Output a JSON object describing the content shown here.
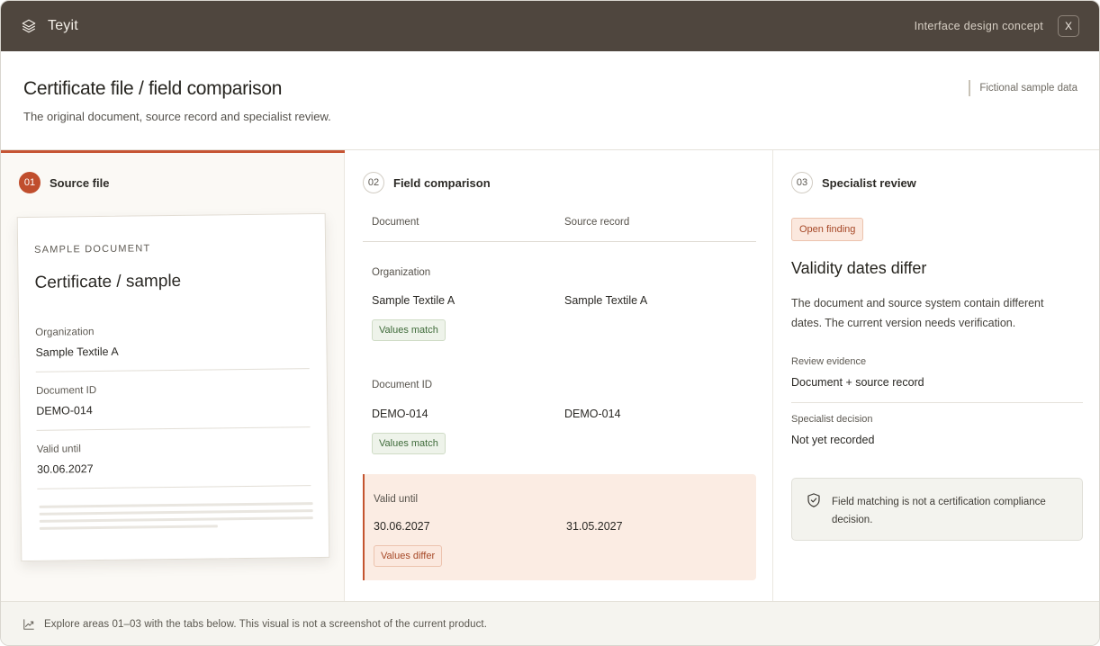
{
  "titlebar": {
    "brand_name": "Teyit",
    "concept_label": "Interface design concept",
    "close_label": "X"
  },
  "header": {
    "title": "Certificate file / field comparison",
    "subtitle": "The original document, source record and specialist review.",
    "sample_tag": "Fictional sample data"
  },
  "steps": [
    {
      "number": "01",
      "label": "Source file"
    },
    {
      "number": "02",
      "label": "Field comparison"
    },
    {
      "number": "03",
      "label": "Specialist review"
    }
  ],
  "document": {
    "kicker": "SAMPLE DOCUMENT",
    "title": "Certificate / sample",
    "fields": [
      {
        "label": "Organization",
        "value": "Sample Textile A"
      },
      {
        "label": "Document ID",
        "value": "DEMO-014"
      },
      {
        "label": "Valid until",
        "value": "30.06.2027"
      }
    ]
  },
  "comparison": {
    "col_document": "Document",
    "col_source": "Source record",
    "rows": [
      {
        "label": "Organization",
        "document": "Sample Textile A",
        "source": "Sample Textile A",
        "status": "Values match"
      },
      {
        "label": "Document ID",
        "document": "DEMO-014",
        "source": "DEMO-014",
        "status": "Values match"
      },
      {
        "label": "Valid until",
        "document": "30.06.2027",
        "source": "31.05.2027",
        "status": "Values differ"
      }
    ]
  },
  "review": {
    "badge": "Open finding",
    "title": "Validity dates differ",
    "text": "The document and source system contain different dates. The current version needs verification.",
    "evidence_label": "Review evidence",
    "evidence_value": "Document + source record",
    "decision_label": "Specialist decision",
    "decision_value": "Not yet recorded",
    "note": "Field matching is not a certification compliance decision."
  },
  "footer": {
    "text": "Explore areas 01–03 with the tabs below. This visual is not a screenshot of the current product."
  },
  "colors": {
    "titlebar": "#4f463e",
    "accent": "#c04e2d",
    "match": "#3f6b3a",
    "differ": "#a64827"
  }
}
